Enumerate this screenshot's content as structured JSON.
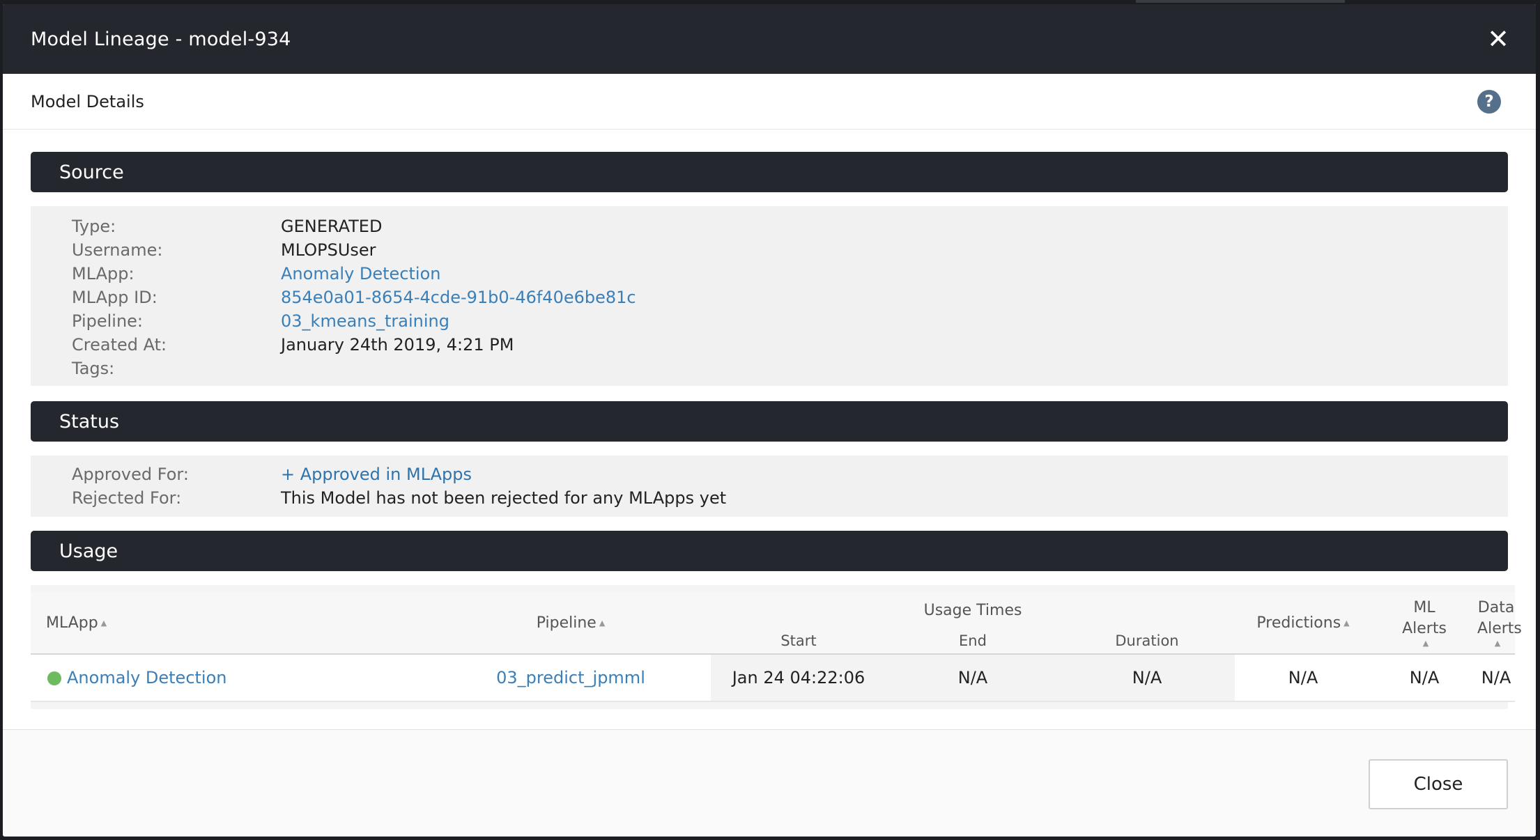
{
  "modal": {
    "title": "Model Lineage - model-934",
    "subheader": "Model Details"
  },
  "icons": {
    "close": "close-icon",
    "help": "help-icon",
    "sort": "sort-caret-icon",
    "status": "status-dot-icon",
    "plus": "plus-icon"
  },
  "colors": {
    "header_bg": "#24272d",
    "link": "#3a7fb8",
    "status_ok": "#6dbb5e"
  },
  "source": {
    "heading": "Source",
    "rows": [
      {
        "key": "Type:",
        "value": "GENERATED"
      },
      {
        "key": "Username:",
        "value": "MLOPSUser"
      },
      {
        "key": "MLApp:",
        "value": "Anomaly Detection"
      },
      {
        "key": "MLApp ID:",
        "value": "854e0a01-8654-4cde-91b0-46f40e6be81c"
      },
      {
        "key": "Pipeline:",
        "value": "03_kmeans_training"
      },
      {
        "key": "Created At:",
        "value": "January 24th 2019, 4:21 PM"
      },
      {
        "key": "Tags:",
        "value": ""
      }
    ]
  },
  "status": {
    "heading": "Status",
    "approved_label": "Approved For:",
    "approved_action": "+ Approved in MLApps",
    "rejected_label": "Rejected For:",
    "rejected_value": "This Model has not been rejected for any MLApps yet"
  },
  "usage": {
    "heading": "Usage",
    "columns": {
      "mlapp": "MLApp",
      "pipeline": "Pipeline",
      "usage_times": "Usage Times",
      "start": "Start",
      "end": "End",
      "duration": "Duration",
      "predictions": "Predictions",
      "ml_alerts_1": "ML",
      "ml_alerts_2": "Alerts",
      "data_alerts_1": "Data",
      "data_alerts_2": "Alerts"
    },
    "rows": [
      {
        "mlapp": "Anomaly Detection",
        "pipeline": "03_predict_jpmml",
        "start": "Jan 24 04:22:06",
        "end": "N/A",
        "duration": "N/A",
        "predictions": "N/A",
        "ml_alerts": "N/A",
        "data_alerts": "N/A"
      }
    ]
  },
  "footer": {
    "close_label": "Close"
  }
}
